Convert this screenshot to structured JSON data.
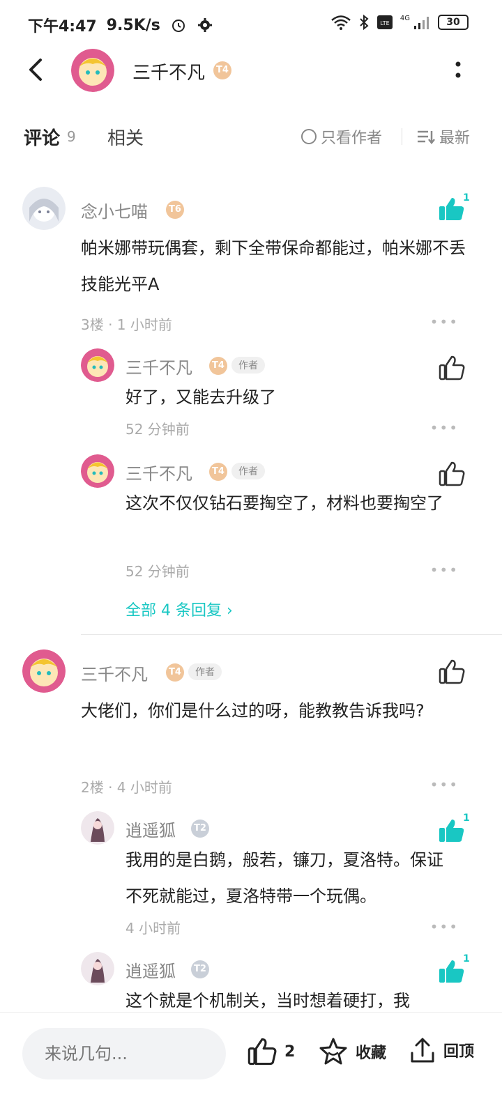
{
  "status_bar": {
    "time": "下午4:47",
    "speed": "9.5K/s",
    "network": "4G",
    "battery": "30"
  },
  "header": {
    "title": "三千不凡",
    "level": "T4"
  },
  "tabs": {
    "comments_label": "评论",
    "comments_count": "9",
    "related_label": "相关",
    "only_author": "只看作者",
    "sort": "最新"
  },
  "author_badge": "作者",
  "comments": [
    {
      "name": "念小七喵",
      "level": "T6",
      "text": "帕米娜带玩偶套，剩下全带保命都能过，帕米娜不丢技能光平A",
      "meta": "3楼 · 1 小时前",
      "likes": "1",
      "replies": [
        {
          "name": "三千不凡",
          "level": "T4",
          "text": "好了，又能去升级了",
          "meta": "52 分钟前"
        },
        {
          "name": "三千不凡",
          "level": "T4",
          "text": "这次不仅仅钻石要掏空了，材料也要掏空了",
          "meta": "52 分钟前"
        }
      ],
      "all_replies": "全部 4 条回复 ›"
    },
    {
      "name": "三千不凡",
      "level": "T4",
      "text": "大佬们，你们是什么过的呀，能教教告诉我吗?",
      "meta": "2楼 · 4 小时前",
      "replies": [
        {
          "name": "逍遥狐",
          "level": "T2",
          "text": "我用的是白鹅，般若，镰刀，夏洛特。保证不死就能过，夏洛特带一个玩偶。",
          "meta": "4 小时前",
          "likes": "1"
        },
        {
          "name": "逍遥狐",
          "level": "T2",
          "text": "这个就是个机制关，当时想着硬打，我",
          "likes": "1"
        }
      ]
    }
  ],
  "bottom_bar": {
    "placeholder": "来说几句...",
    "like_count": "2",
    "collect": "收藏",
    "top": "回顶"
  },
  "colors": {
    "accent": "#19c7c3",
    "gold_level": "#f1c59a",
    "silver_level": "#c9cfd8"
  }
}
